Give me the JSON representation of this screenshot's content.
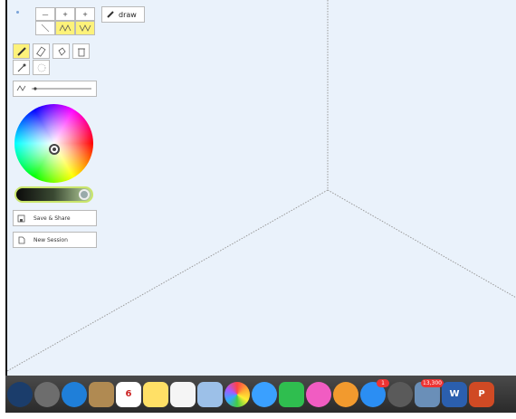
{
  "toolbar": {
    "mode_label": "draw",
    "symmetry_row1": [
      "—",
      "+",
      "+"
    ],
    "tools": [
      "pencil",
      "eraser",
      "bucket",
      "trash",
      "eyedropper",
      "lasso"
    ],
    "active_tools": [
      "pencil"
    ]
  },
  "brush": {
    "size_fraction": 0.15
  },
  "actions": {
    "save_share": "Save & Share",
    "new_session": "New Session"
  },
  "colors": {
    "canvas": "#eaf2fb",
    "highlight": "#fdf27a",
    "dock": "#333333"
  },
  "dock": {
    "apps": [
      {
        "name": "siri",
        "color": "#1b3d6b"
      },
      {
        "name": "launchpad",
        "color": "#6d6d6d"
      },
      {
        "name": "safari",
        "color": "#1f7fd9"
      },
      {
        "name": "contacts",
        "color": "#b08a52"
      },
      {
        "name": "calendar",
        "color": "#ffffff",
        "text": "6"
      },
      {
        "name": "notes",
        "color": "#ffe066"
      },
      {
        "name": "reminders",
        "color": "#f5f5f5"
      },
      {
        "name": "preview",
        "color": "#9cc0e8"
      },
      {
        "name": "photos",
        "color": "#ffffff"
      },
      {
        "name": "messages",
        "color": "#3aa0ff"
      },
      {
        "name": "facetime",
        "color": "#2fbe4f"
      },
      {
        "name": "itunes",
        "color": "#f15cc2"
      },
      {
        "name": "ibooks",
        "color": "#f29a2e"
      },
      {
        "name": "app-store",
        "color": "#2b8ef3",
        "badge": "1"
      },
      {
        "name": "system-preferences",
        "color": "#5a5a5a"
      },
      {
        "name": "photo-app",
        "color": "#6a8fb8",
        "badge": "13,300"
      },
      {
        "name": "word",
        "color": "#2b5fae",
        "text": "W"
      },
      {
        "name": "powerpoint",
        "color": "#d04a24",
        "text": "P"
      }
    ]
  }
}
